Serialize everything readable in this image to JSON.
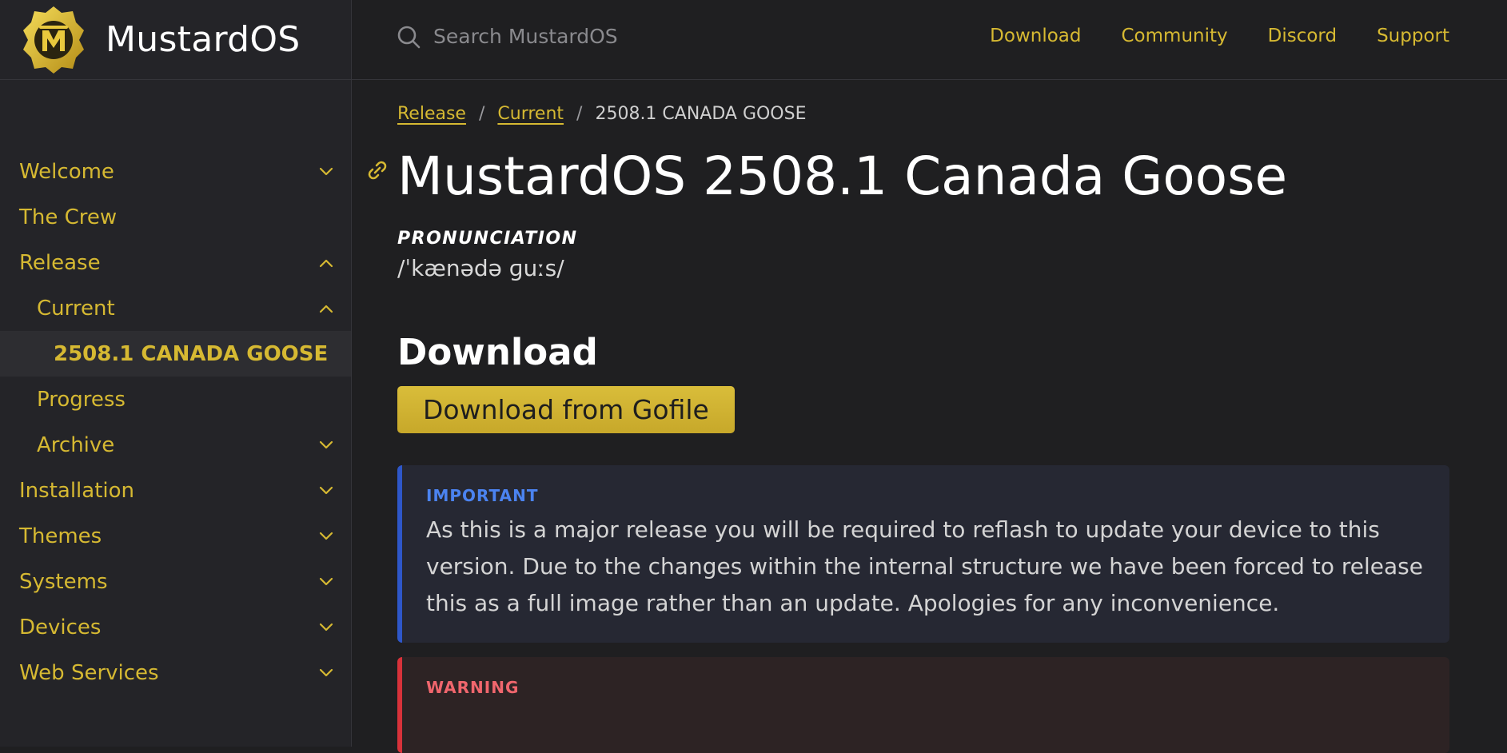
{
  "brand": {
    "name": "MustardOS",
    "logo_icon": "mustard-m-logo",
    "accent": "#d6b932"
  },
  "search": {
    "placeholder": "Search MustardOS"
  },
  "toplinks": [
    "Download",
    "Community",
    "Discord",
    "Support"
  ],
  "sidebar": {
    "items": [
      {
        "label": "Welcome",
        "chevron": "down"
      },
      {
        "label": "The Crew",
        "chevron": ""
      },
      {
        "label": "Release",
        "chevron": "up"
      },
      {
        "label": "Current",
        "chevron": "up"
      },
      {
        "label": "2508.1 CANADA GOOSE",
        "chevron": "",
        "active": true
      },
      {
        "label": "Progress",
        "chevron": ""
      },
      {
        "label": "Archive",
        "chevron": "down"
      },
      {
        "label": "Installation",
        "chevron": "down"
      },
      {
        "label": "Themes",
        "chevron": "down"
      },
      {
        "label": "Systems",
        "chevron": "down"
      },
      {
        "label": "Devices",
        "chevron": "down"
      },
      {
        "label": "Web Services",
        "chevron": "down"
      }
    ]
  },
  "breadcrumb": {
    "items": [
      "Release",
      "Current"
    ],
    "current": "2508.1 CANADA GOOSE",
    "separator": "/"
  },
  "page": {
    "title": "MustardOS 2508.1 Canada Goose",
    "pronunciation_label": "PRONUNCIATION",
    "pronunciation": "/ˈkænədə ɡuːs/",
    "download_heading": "Download",
    "download_button": "Download from Gofile"
  },
  "callouts": {
    "important": {
      "label": "IMPORTANT",
      "text": "As this is a major release you will be required to reflash to update your device to this version. Due to the changes within the internal structure we have been forced to release this as a full image rather than an update. Apologies for any inconvenience.",
      "color": "#2e57c9"
    },
    "warning": {
      "label": "WARNING",
      "text": "",
      "color": "#d8323a"
    }
  }
}
